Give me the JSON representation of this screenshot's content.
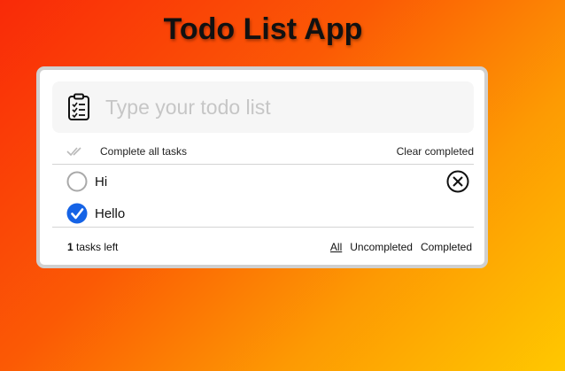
{
  "header": {
    "title": "Todo List App"
  },
  "input": {
    "placeholder": "Type your todo list",
    "value": "",
    "icon": "clipboard-list-icon"
  },
  "toolbar": {
    "complete_all_icon": "double-check-icon",
    "complete_all_label": "Complete all tasks",
    "clear_completed_label": "Clear completed"
  },
  "todos": [
    {
      "text": "Hi",
      "completed": false,
      "show_delete": true
    },
    {
      "text": "Hello",
      "completed": true,
      "show_delete": false
    }
  ],
  "footer": {
    "count": "1",
    "count_suffix": " tasks left",
    "filters": [
      {
        "label": "All",
        "active": true
      },
      {
        "label": "Uncompleted",
        "active": false
      },
      {
        "label": "Completed",
        "active": false
      }
    ]
  },
  "colors": {
    "accent": "#1563e6",
    "gradient_start": "#f92a08",
    "gradient_end": "#ffc800",
    "card_border": "#d0d0d0"
  }
}
